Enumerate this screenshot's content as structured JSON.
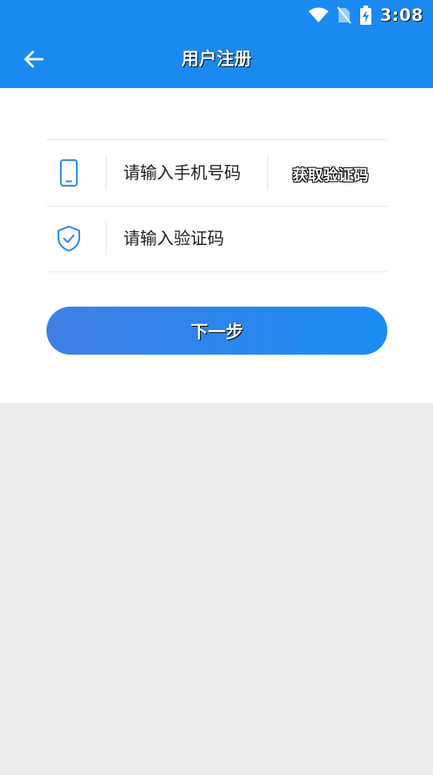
{
  "status_bar": {
    "time": "3:08",
    "icons": [
      "wifi-icon",
      "no-sim-icon",
      "battery-charging-icon"
    ]
  },
  "app_bar": {
    "back_icon": "arrow-left-icon",
    "title": "用户注册"
  },
  "form": {
    "phone": {
      "icon": "phone-icon",
      "placeholder": "请输入手机号码",
      "value": ""
    },
    "get_code_label": "获取验证码",
    "code": {
      "icon": "shield-check-icon",
      "placeholder": "请输入验证码",
      "value": ""
    }
  },
  "next_button_label": "下一步",
  "colors": {
    "primary": "#1a8af1",
    "gradient_start": "#3f7fe6",
    "gradient_end": "#1a8cf2",
    "icon_blue": "#2d8cf0",
    "page_background": "#ececec"
  }
}
